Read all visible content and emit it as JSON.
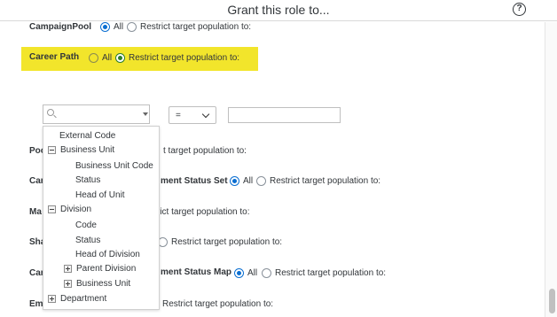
{
  "header": {
    "title": "Grant this role to...",
    "help_icon": "?"
  },
  "rows": [
    {
      "label": "CampaignPool",
      "all": "All",
      "restrict": "Restrict target population to:"
    },
    {
      "label": "Career Path",
      "all": "All",
      "restrict": "Restrict target population to:"
    },
    {
      "label_partial": "Poo",
      "restrict_partial": "t target population to:"
    },
    {
      "label_partial": "Car",
      "middle_partial": "ment Status Set",
      "all": "All",
      "restrict": "Restrict target population to:"
    },
    {
      "label_partial": "Ma",
      "restrict_partial": "rict target population to:"
    },
    {
      "label_partial": "Sha",
      "restrict": "Restrict target population to:"
    },
    {
      "label_partial": "Car",
      "middle_partial": "ment Status Map",
      "all": "All",
      "restrict": "Restrict target population to:"
    },
    {
      "label_partial": "Em",
      "restrict": "Restrict target population to:"
    }
  ],
  "filter": {
    "search_placeholder": "",
    "operator": "=",
    "value": ""
  },
  "tree": [
    {
      "label": "External Code"
    },
    {
      "label": "Business Unit"
    },
    {
      "label": "Business Unit Code"
    },
    {
      "label": "Status"
    },
    {
      "label": "Head of Unit"
    },
    {
      "label": "Division"
    },
    {
      "label": "Code"
    },
    {
      "label": "Status"
    },
    {
      "label": "Head of Division"
    },
    {
      "label": "Parent Division"
    },
    {
      "label": "Business Unit"
    },
    {
      "label": "Department"
    }
  ],
  "colors": {
    "highlight": "#f2e52b",
    "radio_selected": "#0a6ed1",
    "radio_selected_highlight": "#2b7d2b"
  }
}
